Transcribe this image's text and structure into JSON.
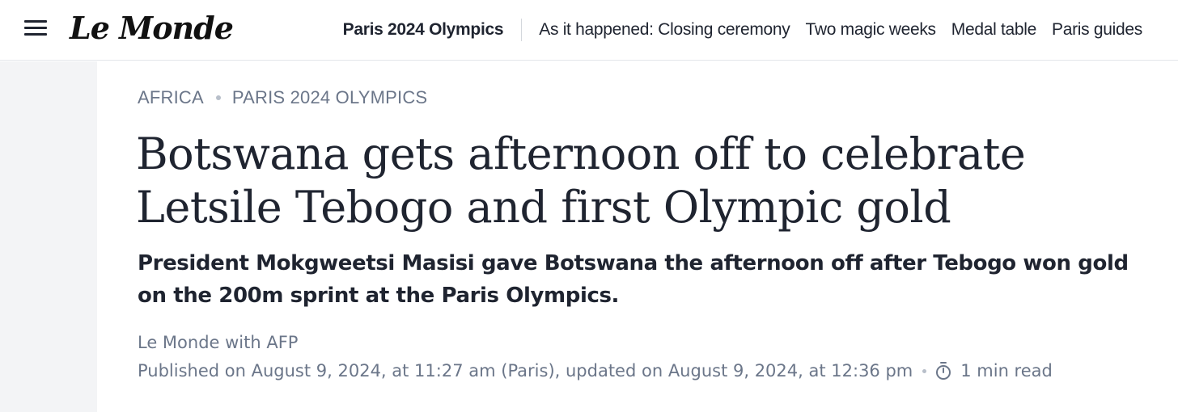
{
  "header": {
    "logo_text": "Le Monde",
    "nav_primary": "Paris 2024 Olympics",
    "nav_items": [
      "As it happened: Closing ceremony",
      "Two magic weeks",
      "Medal table",
      "Paris guides"
    ],
    "menu_icon": "hamburger-icon"
  },
  "article": {
    "kicker": [
      "AFRICA",
      "PARIS 2024 OLYMPICS"
    ],
    "headline": "Botswana gets afternoon off to celebrate Letsile Tebogo and first Olympic gold",
    "standfirst": "President Mokgweetsi Masisi gave Botswana the afternoon off after Tebogo won gold on the 200m sprint at the Paris Olympics.",
    "byline": "Le Monde with AFP",
    "published": "Published on August 9, 2024, at 11:27 am (Paris), updated on August 9, 2024, at 12:36 pm",
    "reading_time_icon": "stopwatch-icon",
    "reading_time": "1 min read"
  },
  "colors": {
    "text": "#1f2430",
    "muted": "#6b7689",
    "gutter": "#f3f4f6"
  }
}
